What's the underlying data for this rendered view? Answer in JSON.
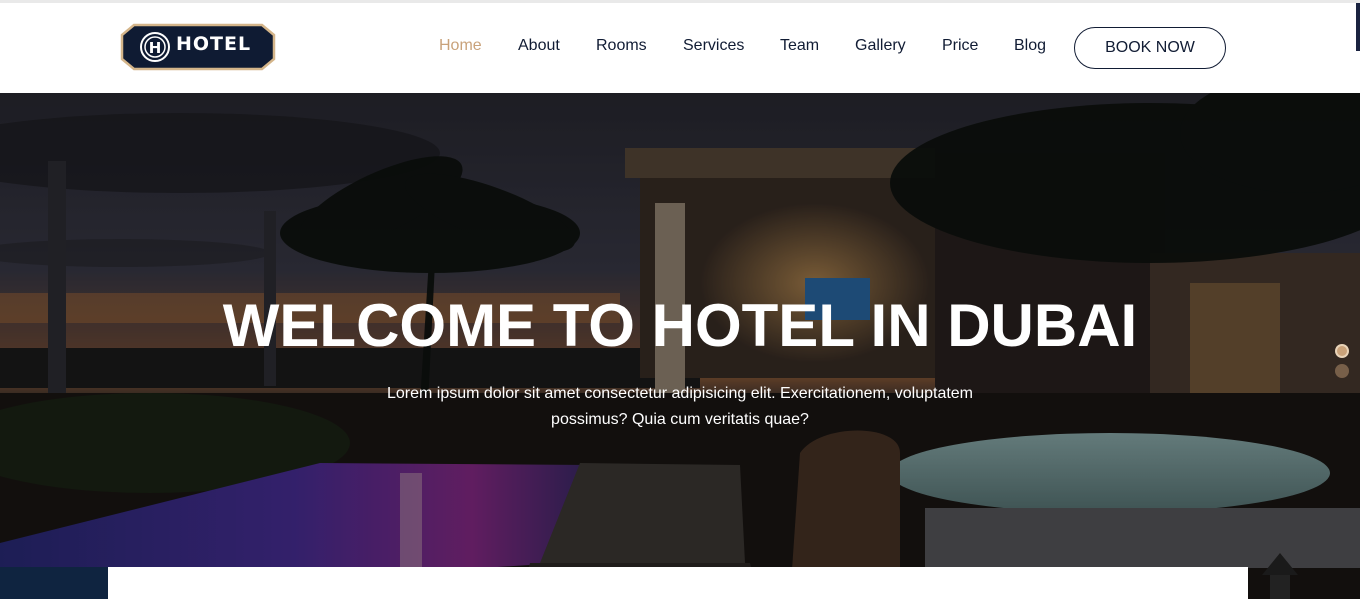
{
  "brand": {
    "name": "HOTEL",
    "badge_letter": "H"
  },
  "nav": {
    "items": [
      {
        "label": "Home",
        "active": true
      },
      {
        "label": "About",
        "active": false
      },
      {
        "label": "Rooms",
        "active": false
      },
      {
        "label": "Services",
        "active": false
      },
      {
        "label": "Team",
        "active": false
      },
      {
        "label": "Gallery",
        "active": false
      },
      {
        "label": "Price",
        "active": false
      },
      {
        "label": "Blog",
        "active": false
      }
    ],
    "cta_label": "BOOK NOW"
  },
  "hero": {
    "title": "WELCOME TO HOTEL IN DUBAI",
    "subtitle": "Lorem ipsum dolor sit amet consectetur adipisicing elit. Exercitationem, voluptatem possimus? Quia cum veritatis quae?",
    "slides_count": 2,
    "active_slide": 1
  },
  "colors": {
    "accent": "#c9a27a",
    "navy": "#111c34",
    "logo_bg": "#0f1b33",
    "logo_border": "#d4b58a"
  }
}
